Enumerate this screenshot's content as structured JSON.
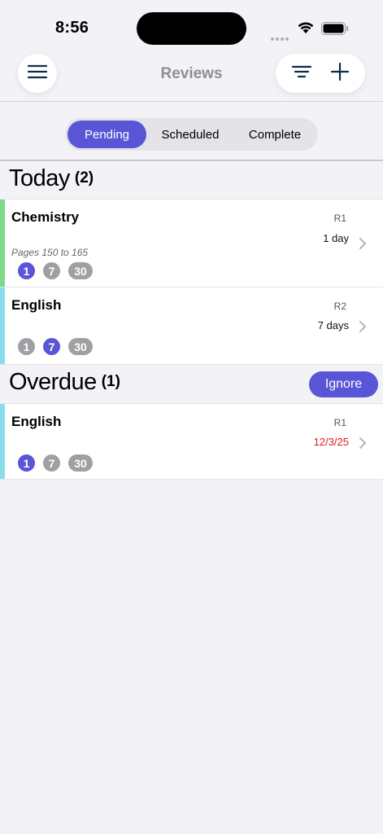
{
  "status_bar": {
    "time": "8:56"
  },
  "nav": {
    "title": "Reviews"
  },
  "tabs": [
    {
      "label": "Pending",
      "active": true
    },
    {
      "label": "Scheduled",
      "active": false
    },
    {
      "label": "Complete",
      "active": false
    }
  ],
  "today": {
    "title": "Today",
    "count": "(2)",
    "items": [
      {
        "subject": "Chemistry",
        "round": "R1",
        "due": "1 day",
        "note": "Pages 150 to 165",
        "stages": [
          "1",
          "7",
          "30"
        ],
        "active_stage": 0,
        "accent": "#7ED88A"
      },
      {
        "subject": "English",
        "round": "R2",
        "due": "7 days",
        "note": "",
        "stages": [
          "1",
          "7",
          "30"
        ],
        "active_stage": 1,
        "accent": "#8ADDEA"
      }
    ]
  },
  "overdue": {
    "title": "Overdue",
    "count": "(1)",
    "ignore_label": "Ignore",
    "items": [
      {
        "subject": "English",
        "round": "R1",
        "due": "12/3/25",
        "stages": [
          "1",
          "7",
          "30"
        ],
        "active_stage": 0,
        "accent": "#8ADDEA",
        "due_color": "#E0191C"
      }
    ]
  },
  "colors": {
    "accent": "#5856D6",
    "background": "#F2F2F7",
    "inactive_pill": "#A0A0A4"
  },
  "icons": [
    "hamburger-icon",
    "filter-icon",
    "plus-icon",
    "chevron-right-icon",
    "wifi-icon",
    "battery-icon"
  ]
}
